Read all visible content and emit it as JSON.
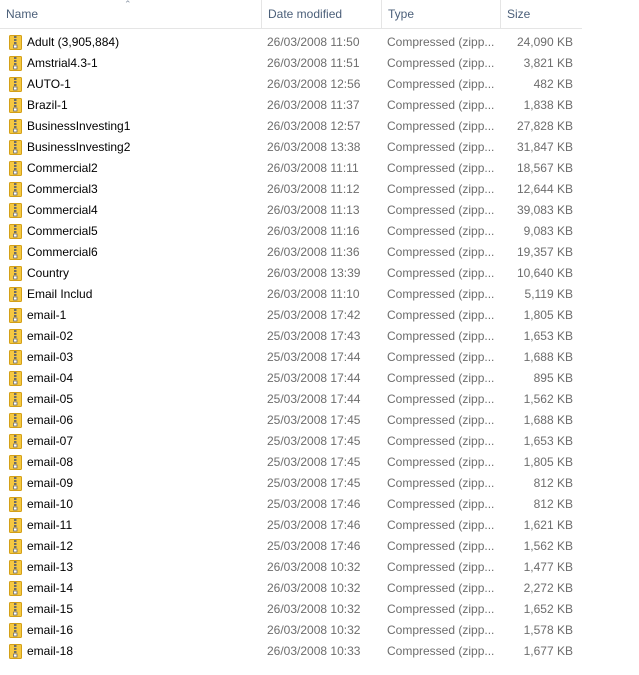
{
  "columns": {
    "name": "Name",
    "date": "Date modified",
    "type": "Type",
    "size": "Size"
  },
  "sort_icon": "sort-ascending-arrow",
  "files": [
    {
      "name": "Adult (3,905,884)",
      "date": "26/03/2008 11:50",
      "type": "Compressed (zipp...",
      "size": "24,090 KB"
    },
    {
      "name": "Amstrial4.3-1",
      "date": "26/03/2008 11:51",
      "type": "Compressed (zipp...",
      "size": "3,821 KB"
    },
    {
      "name": "AUTO-1",
      "date": "26/03/2008 12:56",
      "type": "Compressed (zipp...",
      "size": "482 KB"
    },
    {
      "name": "Brazil-1",
      "date": "26/03/2008 11:37",
      "type": "Compressed (zipp...",
      "size": "1,838 KB"
    },
    {
      "name": "BusinessInvesting1",
      "date": "26/03/2008 12:57",
      "type": "Compressed (zipp...",
      "size": "27,828 KB"
    },
    {
      "name": "BusinessInvesting2",
      "date": "26/03/2008 13:38",
      "type": "Compressed (zipp...",
      "size": "31,847 KB"
    },
    {
      "name": "Commercial2",
      "date": "26/03/2008 11:11",
      "type": "Compressed (zipp...",
      "size": "18,567 KB"
    },
    {
      "name": "Commercial3",
      "date": "26/03/2008 11:12",
      "type": "Compressed (zipp...",
      "size": "12,644 KB"
    },
    {
      "name": "Commercial4",
      "date": "26/03/2008 11:13",
      "type": "Compressed (zipp...",
      "size": "39,083 KB"
    },
    {
      "name": "Commercial5",
      "date": "26/03/2008 11:16",
      "type": "Compressed (zipp...",
      "size": "9,083 KB"
    },
    {
      "name": "Commercial6",
      "date": "26/03/2008 11:36",
      "type": "Compressed (zipp...",
      "size": "19,357 KB"
    },
    {
      "name": "Country",
      "date": "26/03/2008 13:39",
      "type": "Compressed (zipp...",
      "size": "10,640 KB"
    },
    {
      "name": "Email Includ",
      "date": "26/03/2008 11:10",
      "type": "Compressed (zipp...",
      "size": "5,119 KB"
    },
    {
      "name": "email-1",
      "date": "25/03/2008 17:42",
      "type": "Compressed (zipp...",
      "size": "1,805 KB"
    },
    {
      "name": "email-02",
      "date": "25/03/2008 17:43",
      "type": "Compressed (zipp...",
      "size": "1,653 KB"
    },
    {
      "name": "email-03",
      "date": "25/03/2008 17:44",
      "type": "Compressed (zipp...",
      "size": "1,688 KB"
    },
    {
      "name": "email-04",
      "date": "25/03/2008 17:44",
      "type": "Compressed (zipp...",
      "size": "895 KB"
    },
    {
      "name": "email-05",
      "date": "25/03/2008 17:44",
      "type": "Compressed (zipp...",
      "size": "1,562 KB"
    },
    {
      "name": "email-06",
      "date": "25/03/2008 17:45",
      "type": "Compressed (zipp...",
      "size": "1,688 KB"
    },
    {
      "name": "email-07",
      "date": "25/03/2008 17:45",
      "type": "Compressed (zipp...",
      "size": "1,653 KB"
    },
    {
      "name": "email-08",
      "date": "25/03/2008 17:45",
      "type": "Compressed (zipp...",
      "size": "1,805 KB"
    },
    {
      "name": "email-09",
      "date": "25/03/2008 17:45",
      "type": "Compressed (zipp...",
      "size": "812 KB"
    },
    {
      "name": "email-10",
      "date": "25/03/2008 17:46",
      "type": "Compressed (zipp...",
      "size": "812 KB"
    },
    {
      "name": "email-11",
      "date": "25/03/2008 17:46",
      "type": "Compressed (zipp...",
      "size": "1,621 KB"
    },
    {
      "name": "email-12",
      "date": "25/03/2008 17:46",
      "type": "Compressed (zipp...",
      "size": "1,562 KB"
    },
    {
      "name": "email-13",
      "date": "26/03/2008 10:32",
      "type": "Compressed (zipp...",
      "size": "1,477 KB"
    },
    {
      "name": "email-14",
      "date": "26/03/2008 10:32",
      "type": "Compressed (zipp...",
      "size": "2,272 KB"
    },
    {
      "name": "email-15",
      "date": "26/03/2008 10:32",
      "type": "Compressed (zipp...",
      "size": "1,652 KB"
    },
    {
      "name": "email-16",
      "date": "26/03/2008 10:32",
      "type": "Compressed (zipp...",
      "size": "1,578 KB"
    },
    {
      "name": "email-18",
      "date": "26/03/2008 10:33",
      "type": "Compressed (zipp...",
      "size": "1,677 KB"
    }
  ],
  "file_icon": "zip-folder-icon",
  "colors": {
    "header_text": "#4c607a",
    "detail_text": "#6d6d6d",
    "name_text": "#000000",
    "folder_yellow": "#f5c841",
    "zipper": "#6b6b6b"
  }
}
